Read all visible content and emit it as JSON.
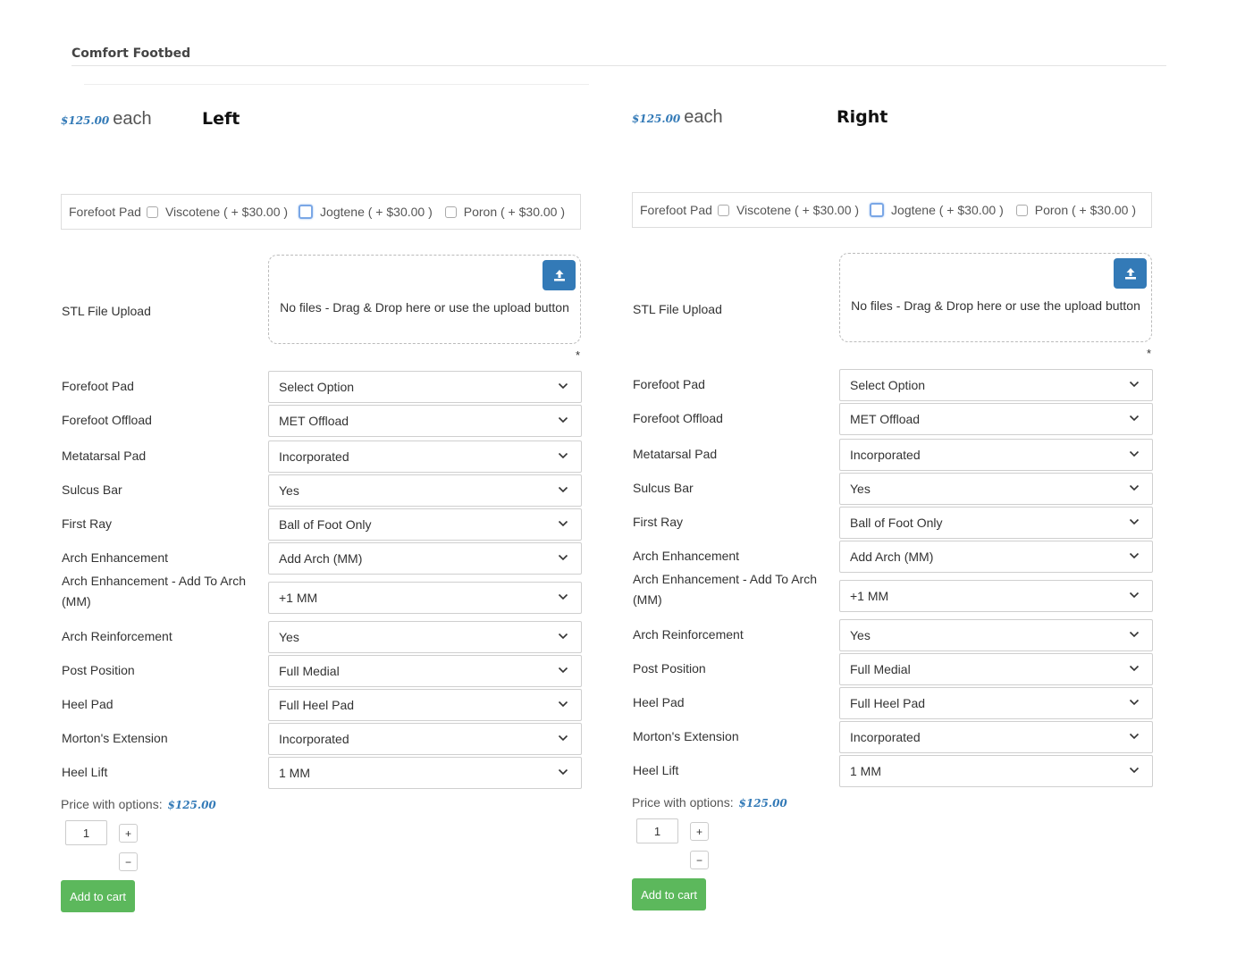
{
  "page": {
    "title": "Comfort Footbed"
  },
  "panels": [
    {
      "side": "Left",
      "price": "$125.00",
      "each": "each",
      "forefoot_group": {
        "label": "Forefoot Pad",
        "options": [
          "Viscotene ( + $30.00 )",
          "Jogtene ( + $30.00 )",
          "Poron ( + $30.00 )"
        ]
      },
      "upload": {
        "label": "STL File Upload",
        "text": "No files - Drag & Drop here or use the upload button",
        "required": "*"
      },
      "fields": [
        {
          "label": "Forefoot Pad",
          "value": "Select Option"
        },
        {
          "label": "Forefoot Offload",
          "value": "MET Offload"
        },
        {
          "label": "Metatarsal Pad",
          "value": "Incorporated"
        },
        {
          "label": "Sulcus Bar",
          "value": "Yes"
        },
        {
          "label": "First Ray",
          "value": "Ball of Foot Only"
        },
        {
          "label": "Arch Enhancement",
          "value": "Add Arch (MM)"
        },
        {
          "label": "Arch Enhancement - Add To Arch (MM)",
          "value": "+1 MM"
        },
        {
          "label": "Arch Reinforcement",
          "value": "Yes"
        },
        {
          "label": "Post Position",
          "value": "Full Medial"
        },
        {
          "label": "Heel Pad",
          "value": "Full Heel Pad"
        },
        {
          "label": "Morton's Extension",
          "value": "Incorporated"
        },
        {
          "label": "Heel Lift",
          "value": "1 MM"
        }
      ],
      "price_with_options_label": "Price with options:",
      "price_with_options": "$125.00",
      "quantity": "1",
      "plus": "+",
      "minus": "−",
      "add_to_cart": "Add to cart"
    },
    {
      "side": "Right",
      "price": "$125.00",
      "each": "each",
      "forefoot_group": {
        "label": "Forefoot Pad",
        "options": [
          "Viscotene ( + $30.00 )",
          "Jogtene ( + $30.00 )",
          "Poron ( + $30.00 )"
        ]
      },
      "upload": {
        "label": "STL File Upload",
        "text": "No files - Drag & Drop here or use the upload button",
        "required": "*"
      },
      "fields": [
        {
          "label": "Forefoot Pad",
          "value": "Select Option"
        },
        {
          "label": "Forefoot Offload",
          "value": "MET Offload"
        },
        {
          "label": "Metatarsal Pad",
          "value": "Incorporated"
        },
        {
          "label": "Sulcus Bar",
          "value": "Yes"
        },
        {
          "label": "First Ray",
          "value": "Ball of Foot Only"
        },
        {
          "label": "Arch Enhancement",
          "value": "Add Arch (MM)"
        },
        {
          "label": "Arch Enhancement - Add To Arch (MM)",
          "value": "+1 MM"
        },
        {
          "label": "Arch Reinforcement",
          "value": "Yes"
        },
        {
          "label": "Post Position",
          "value": "Full Medial"
        },
        {
          "label": "Heel Pad",
          "value": "Full Heel Pad"
        },
        {
          "label": "Morton's Extension",
          "value": "Incorporated"
        },
        {
          "label": "Heel Lift",
          "value": "1 MM"
        }
      ],
      "price_with_options_label": "Price with options:",
      "price_with_options": "$125.00",
      "quantity": "1",
      "plus": "+",
      "minus": "−",
      "add_to_cart": "Add to cart"
    }
  ],
  "colors": {
    "accent": "#337ab7",
    "cart": "#5cb85c",
    "price": "#337ab7"
  },
  "icons": {
    "upload": "upload-icon",
    "select": "chevron-down-icon"
  }
}
